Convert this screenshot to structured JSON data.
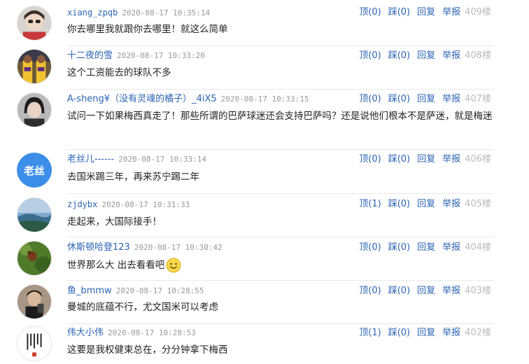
{
  "comments": [
    {
      "user": "xiang_zpqb",
      "time": "2020-08-17 10:35:14",
      "up": "顶(0)",
      "down": "踩(0)",
      "reply": "回复",
      "report": "举报",
      "floor": "409楼",
      "text": "你去哪里我就跟你去哪里！就这么简单"
    },
    {
      "user": "十二夜的雪",
      "time": "2020-08-17 10:33:20",
      "up": "顶(0)",
      "down": "踩(0)",
      "reply": "回复",
      "report": "举报",
      "floor": "408楼",
      "text": "这个工资能去的球队不多"
    },
    {
      "user": "A-sheng¥（没有灵魂的橘子）_4iX5",
      "time": "2020-08-17 10:33:15",
      "up": "顶(0)",
      "down": "踩(0)",
      "reply": "回复",
      "report": "举报",
      "floor": "407楼",
      "text": "试问一下如果梅西真走了！那些所谓的巴萨球迷还会支持巴萨吗？还是说他们根本不是萨迷，就是梅迷"
    },
    {
      "user": "老丝儿------",
      "time": "2020-08-17 10:33:14",
      "up": "顶(0)",
      "down": "踩(0)",
      "reply": "回复",
      "report": "举报",
      "floor": "406楼",
      "text": "去国米踢三年，再来苏宁踢二年",
      "avatar_text": "老丝"
    },
    {
      "user": "zjdybx",
      "time": "2020-08-17 10:31:33",
      "up": "顶(1)",
      "down": "踩(0)",
      "reply": "回复",
      "report": "举报",
      "floor": "405楼",
      "text": "走起来，大国际接手！"
    },
    {
      "user": "休斯顿哈登123",
      "time": "2020-08-17 10:30:42",
      "up": "顶(0)",
      "down": "踩(0)",
      "reply": "回复",
      "report": "举报",
      "floor": "404楼",
      "text": "世界那么大 出去看看吧"
    },
    {
      "user": "鱼_bmmw",
      "time": "2020-08-17 10:28:55",
      "up": "顶(0)",
      "down": "踩(0)",
      "reply": "回复",
      "report": "举报",
      "floor": "403楼",
      "text": "曼城的底蕴不行，尤文国米可以考虑"
    },
    {
      "user": "伟大小伟",
      "time": "2020-08-17 10:28:53",
      "up": "顶(1)",
      "down": "踩(0)",
      "reply": "回复",
      "report": "举报",
      "floor": "402楼",
      "text": "这要是我权健束总在，分分钟拿下梅西"
    }
  ],
  "icons": {
    "smiley": "smiley-emoji-icon"
  },
  "colors": {
    "link": "#2d64b3",
    "time": "#999999",
    "floor": "#bbbbbb",
    "separator": "#e8e8e8",
    "avatar_blue": "#3d8ee8"
  }
}
